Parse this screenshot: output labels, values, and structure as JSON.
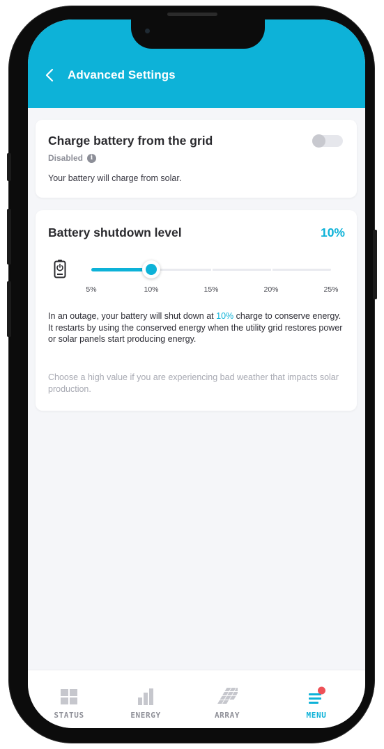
{
  "header": {
    "title": "Advanced Settings",
    "back_icon": "chevron-left-icon",
    "background": "#0db2d8"
  },
  "grid_charging": {
    "title": "Charge battery from the grid",
    "status": "Disabled",
    "status_icon": "info-icon",
    "description": "Your battery will charge from solar.",
    "enabled": false
  },
  "shutdown": {
    "title": "Battery shutdown level",
    "value_label": "10%",
    "icon": "battery-power-icon",
    "slider": {
      "value_percent": 10,
      "min_percent": 5,
      "max_percent": 25,
      "ticks": [
        "5%",
        "10%",
        "15%",
        "20%",
        "25%"
      ]
    },
    "description_before": "In an outage, your battery will shut down at ",
    "description_highlight": "10%",
    "description_after": " charge to conserve energy. It restarts by using the conserved energy when the utility grid restores power or solar panels start producing energy.",
    "hint": "Choose a high value if you are experiencing bad weather that impacts solar production."
  },
  "tabbar": {
    "tabs": [
      {
        "label": "STATUS",
        "icon": "status-grid-icon",
        "active": false
      },
      {
        "label": "ENERGY",
        "icon": "energy-bars-icon",
        "active": false
      },
      {
        "label": "ARRAY",
        "icon": "solar-array-icon",
        "active": false
      },
      {
        "label": "MENU",
        "icon": "menu-icon",
        "active": true,
        "badge": true
      }
    ]
  },
  "colors": {
    "accent": "#0db2d8",
    "badge": "#ee5157",
    "inactive": "#c6c7cd"
  }
}
